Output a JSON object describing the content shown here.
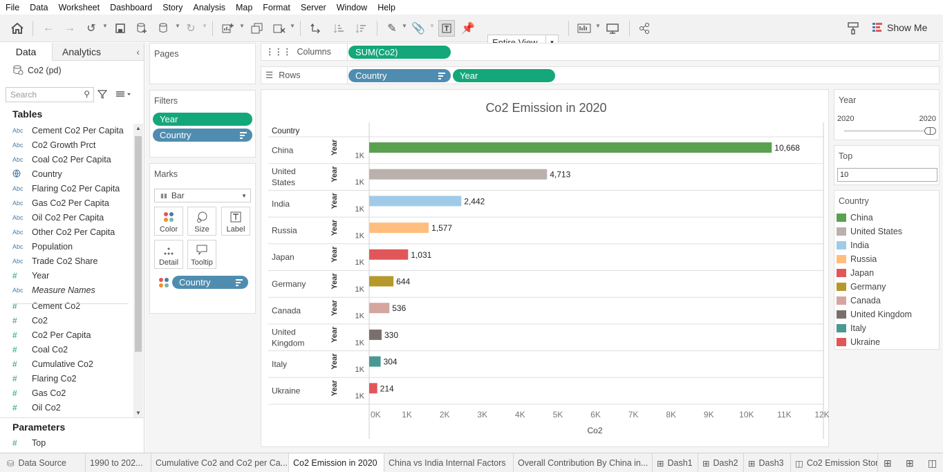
{
  "menu": [
    "File",
    "Data",
    "Worksheet",
    "Dashboard",
    "Story",
    "Analysis",
    "Map",
    "Format",
    "Server",
    "Window",
    "Help"
  ],
  "toolbar": {
    "view_select": "Entire View",
    "show_me": "Show Me"
  },
  "left": {
    "tab_data": "Data",
    "tab_analytics": "Analytics",
    "datasource": "Co2  (pd)",
    "search_placeholder": "Search",
    "tables_head": "Tables",
    "fields": [
      {
        "icon": "Abc",
        "label": "Cement Co2 Per Capita"
      },
      {
        "icon": "Abc",
        "label": "Co2 Growth Prct"
      },
      {
        "icon": "Abc",
        "label": "Coal Co2 Per Capita"
      },
      {
        "icon": "globe",
        "label": "Country"
      },
      {
        "icon": "Abc",
        "label": "Flaring Co2 Per Capita"
      },
      {
        "icon": "Abc",
        "label": "Gas Co2 Per Capita"
      },
      {
        "icon": "Abc",
        "label": "Oil Co2 Per Capita"
      },
      {
        "icon": "Abc",
        "label": "Other Co2 Per Capita"
      },
      {
        "icon": "Abc",
        "label": "Population"
      },
      {
        "icon": "Abc",
        "label": "Trade Co2 Share"
      },
      {
        "icon": "#",
        "label": "Year"
      },
      {
        "icon": "Abc",
        "label": "Measure Names"
      },
      {
        "icon": "#",
        "label": "Cement Co2"
      },
      {
        "icon": "#",
        "label": "Co2"
      },
      {
        "icon": "#",
        "label": "Co2 Per Capita"
      },
      {
        "icon": "#",
        "label": "Coal Co2"
      },
      {
        "icon": "#",
        "label": "Cumulative Co2"
      },
      {
        "icon": "#",
        "label": "Flaring Co2"
      },
      {
        "icon": "#",
        "label": "Gas Co2"
      },
      {
        "icon": "#",
        "label": "Oil Co2"
      }
    ],
    "params_head": "Parameters",
    "params": [
      {
        "icon": "#",
        "label": "Top"
      }
    ]
  },
  "pages": {
    "title": "Pages"
  },
  "filters": {
    "title": "Filters",
    "pills": [
      "Year",
      "Country"
    ]
  },
  "marks": {
    "title": "Marks",
    "type": "Bar",
    "buttons": [
      "Color",
      "Size",
      "Label",
      "Detail",
      "Tooltip"
    ],
    "pill": "Country"
  },
  "shelves": {
    "columns_label": "Columns",
    "columns_pill": "SUM(Co2)",
    "rows_label": "Rows",
    "rows_pills": [
      "Country",
      "Year"
    ]
  },
  "viz": {
    "title": "Co2 Emission in 2020",
    "row_header": "Country",
    "year_axis": "Year",
    "year_tick": "1K"
  },
  "chart_data": {
    "type": "bar",
    "title": "Co2 Emission in 2020",
    "categories": [
      "China",
      "United States",
      "India",
      "Russia",
      "Japan",
      "Germany",
      "Canada",
      "United Kingdom",
      "Italy",
      "Ukraine"
    ],
    "category_labels": [
      [
        "China"
      ],
      [
        "United",
        "States"
      ],
      [
        "India"
      ],
      [
        "Russia"
      ],
      [
        "Japan"
      ],
      [
        "Germany"
      ],
      [
        "Canada"
      ],
      [
        "United",
        "Kingdom"
      ],
      [
        "Italy"
      ],
      [
        "Ukraine"
      ]
    ],
    "values": [
      10668,
      4713,
      2442,
      1577,
      1031,
      644,
      536,
      330,
      304,
      214
    ],
    "value_labels": [
      "10,668",
      "4,713",
      "2,442",
      "1,577",
      "1,031",
      "644",
      "536",
      "330",
      "304",
      "214"
    ],
    "colors": [
      "#59a14f",
      "#bab0ac",
      "#a0cbe8",
      "#ffbe7d",
      "#e15759",
      "#b6992d",
      "#d4a6a0",
      "#79706e",
      "#499894",
      "#e15759"
    ],
    "xlabel": "Co2",
    "xlim": [
      0,
      12000
    ],
    "xticks": [
      "0K",
      "1K",
      "2K",
      "3K",
      "4K",
      "5K",
      "6K",
      "7K",
      "8K",
      "9K",
      "10K",
      "11K",
      "12K"
    ],
    "orientation": "horizontal"
  },
  "year_filter": {
    "title": "Year",
    "min": "2020",
    "max": "2020"
  },
  "top_param": {
    "title": "Top",
    "value": "10"
  },
  "legend": {
    "title": "Country",
    "items": [
      {
        "label": "China",
        "color": "#59a14f"
      },
      {
        "label": "United States",
        "color": "#bab0ac"
      },
      {
        "label": "India",
        "color": "#a0cbe8"
      },
      {
        "label": "Russia",
        "color": "#ffbe7d"
      },
      {
        "label": "Japan",
        "color": "#e15759"
      },
      {
        "label": "Germany",
        "color": "#b6992d"
      },
      {
        "label": "Canada",
        "color": "#d4a6a0"
      },
      {
        "label": "United Kingdom",
        "color": "#79706e"
      },
      {
        "label": "Italy",
        "color": "#499894"
      },
      {
        "label": "Ukraine",
        "color": "#e15759"
      }
    ]
  },
  "bottom_tabs": [
    "Data Source",
    "1990 to 202...",
    "Cumulative Co2 and Co2 per Ca...",
    "Co2 Emission in 2020",
    "China vs India Internal Factors",
    "Overall Contribution  By China in...",
    "Dash1",
    "Dash2",
    "Dash3",
    "Co2 Emission Stor"
  ]
}
